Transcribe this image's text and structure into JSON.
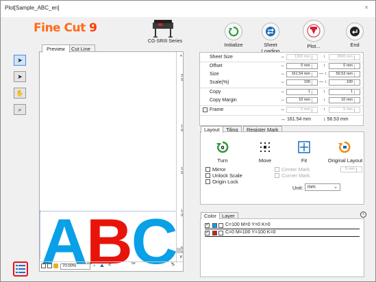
{
  "window": {
    "title": "Plot[Sample_ABC_en]",
    "close_glyph": "×"
  },
  "logo": {
    "part1": "Fine Cut ",
    "part2": "9"
  },
  "device": {
    "label": "CG-SRIII Series"
  },
  "tabs_left": [
    {
      "label": "Preview"
    },
    {
      "label": "Cut Line"
    }
  ],
  "toolbar": {
    "buttons": [
      {
        "label": "Initialize",
        "icon": "refresh-icon",
        "color": "#2a9a3a"
      },
      {
        "label": "Sheet Loading",
        "icon": "swap-arrows-icon",
        "color": "#1a6ab8"
      },
      {
        "label": "Plot...",
        "icon": "plot-icon",
        "color": "#d42030"
      },
      {
        "label": "End",
        "icon": "return-icon",
        "color": "#222222"
      }
    ]
  },
  "preview": {
    "text_a": "A",
    "text_b": "B",
    "text_c": "C",
    "ruler_v": [
      "2",
      "5",
      "1",
      "0",
      "1",
      "5",
      "1",
      "0",
      "5",
      "0"
    ],
    "ruler_h": [
      "150",
      "100",
      "50",
      "0"
    ],
    "zoom": "70.00%",
    "scroll_left": "<",
    "scroll_right": ">",
    "scroll_up": "^",
    "scroll_down": "v"
  },
  "settings": {
    "rows": [
      {
        "name": "Sheet Size",
        "arrow": "↔",
        "v1": "1300 mm",
        "v2": "2000 mm"
      },
      {
        "name": "Offset",
        "arrow": "↔",
        "v1": "0 mm",
        "v2": "0 mm"
      },
      {
        "name": "Size",
        "arrow": "↔",
        "v1": "161.54 mm",
        "v2": "56.53 mm"
      },
      {
        "name": "Scale(%)",
        "arrow": "↔",
        "v1": "100",
        "v2": "100"
      },
      {
        "name": "Copy",
        "arrow": "↔",
        "v1": "1",
        "v2": "1"
      },
      {
        "name": "Copy Margin",
        "arrow": "↔",
        "v1": "10 mm",
        "v2": "10 mm"
      },
      {
        "name": "Frame",
        "arrow": "↔",
        "v1": "5 mm",
        "v2": "5 mm"
      }
    ],
    "vert_arrow": "↕",
    "link_glyph": "—",
    "frame_size_w": "↔ 161.54 mm",
    "frame_size_h": "↕ 56.53 mm"
  },
  "layout_tabs": [
    {
      "label": "Layout"
    },
    {
      "label": "Tiling"
    },
    {
      "label": "Register Mark"
    }
  ],
  "layout": {
    "actions": [
      {
        "label": "Turn"
      },
      {
        "label": "Move"
      },
      {
        "label": "Fit"
      },
      {
        "label": "Original Layout"
      }
    ],
    "options": {
      "mirror": "Mirror",
      "unlock_scale": "Unlock Scale",
      "origin_lock": "Origin Lock",
      "center_mark": "Center Mark",
      "corner_mark": "Corner Mark"
    },
    "mark_size": "5 mm",
    "unit_label": "Unit:",
    "unit_value": "mm"
  },
  "color_tabs": [
    {
      "label": "Color"
    },
    {
      "label": "Layer"
    }
  ],
  "color_list": [
    {
      "label": "C=100 M=0 Y=0 K=0",
      "color": "#0aa0e8"
    },
    {
      "label": "C=0 M=100 Y=100 K=0",
      "color": "#e8140a"
    }
  ]
}
